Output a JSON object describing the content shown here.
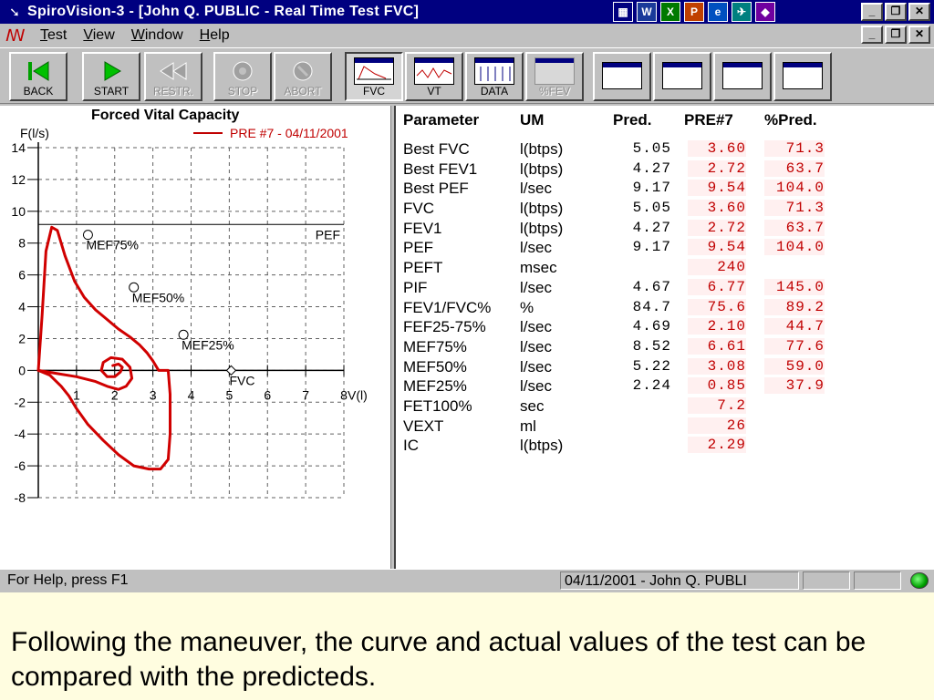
{
  "window": {
    "title": "SpiroVision-3 - [John Q. PUBLIC - Real Time Test FVC]",
    "min_glyph": "_",
    "max_glyph": "❐",
    "close_glyph": "✕"
  },
  "title_icons": [
    {
      "icon": "keyboard-icon",
      "glyph": "▦"
    },
    {
      "icon": "word-icon",
      "glyph": "W"
    },
    {
      "icon": "excel-icon",
      "glyph": "X"
    },
    {
      "icon": "powerpoint-icon",
      "glyph": "P"
    },
    {
      "icon": "ie-icon",
      "glyph": "e"
    },
    {
      "icon": "bird-icon",
      "glyph": "✈"
    },
    {
      "icon": "palette-icon",
      "glyph": "◆"
    }
  ],
  "menu": [
    "Test",
    "View",
    "Window",
    "Help"
  ],
  "toolbar": {
    "buttons": [
      {
        "label": "BACK",
        "icon": "back-icon",
        "enabled": true
      },
      {
        "label": "START",
        "icon": "play-icon",
        "enabled": true
      },
      {
        "label": "RESTR.",
        "icon": "rewind-icon",
        "enabled": false
      },
      {
        "label": "STOP",
        "icon": "stop-icon",
        "enabled": false
      },
      {
        "label": "ABORT",
        "icon": "abort-icon",
        "enabled": false
      }
    ],
    "views": [
      {
        "label": "FVC",
        "icon": "fvc-chart-icon",
        "pressed": true
      },
      {
        "label": "VT",
        "icon": "vt-chart-icon",
        "pressed": false
      },
      {
        "label": "DATA",
        "icon": "data-table-icon",
        "pressed": false
      },
      {
        "label": "%FEV",
        "icon": "fev-percent-icon",
        "pressed": false,
        "enabled": false
      }
    ],
    "extra_icons": [
      "report-icon",
      "multi-window-icon",
      "trend-icon",
      "print-preview-icon"
    ]
  },
  "chart_data": {
    "type": "line",
    "title": "Forced Vital Capacity",
    "legend": "PRE #7 - 04/11/2001",
    "ylabel": "F(l/s)",
    "xlabel": "V(l)",
    "xlim": [
      0,
      8
    ],
    "ylim": [
      -8,
      14
    ],
    "x_ticks": [
      "1",
      "2",
      "3",
      "4",
      "5",
      "6",
      "7",
      "8"
    ],
    "y_ticks": [
      "14",
      "12",
      "10",
      "8",
      "6",
      "4",
      "2",
      "0",
      "-2",
      "-4",
      "-6",
      "-8"
    ],
    "grid": true,
    "pef_line": {
      "y": 9.17,
      "label": "PEF"
    },
    "predicted_markers": [
      {
        "label": "MEF75%",
        "x": 1.3,
        "y": 8.52
      },
      {
        "label": "MEF50%",
        "x": 2.5,
        "y": 5.22
      },
      {
        "label": "MEF25%",
        "x": 3.8,
        "y": 2.24
      },
      {
        "label": "FVC",
        "x": 5.05,
        "y": 0
      }
    ],
    "series": [
      {
        "color": "#d00000",
        "x": [
          0.0,
          0.1,
          0.2,
          0.35,
          0.5,
          0.7,
          0.95,
          1.2,
          1.5,
          1.8,
          2.1,
          2.4,
          2.65,
          2.85,
          3.0,
          3.1,
          3.15,
          3.2,
          3.4,
          3.45,
          3.45,
          3.4,
          3.2,
          2.9,
          2.5,
          2.1,
          1.7,
          1.3,
          1.0,
          0.8,
          0.6,
          0.3,
          0.0
        ],
        "y": [
          0,
          3.5,
          7.5,
          9.0,
          8.8,
          7.2,
          5.6,
          4.6,
          3.8,
          3.2,
          2.6,
          2.1,
          1.6,
          1.1,
          0.6,
          0.2,
          0.0,
          0.0,
          0.0,
          -1.5,
          -4.0,
          -5.6,
          -6.2,
          -6.2,
          -6.0,
          -5.3,
          -4.4,
          -3.4,
          -2.4,
          -1.6,
          -1.0,
          -0.3,
          0.0
        ]
      },
      {
        "color": "#d00000",
        "x": [
          0.0,
          0.5,
          1.0,
          1.5,
          1.8,
          2.1,
          2.3,
          2.45,
          2.4,
          2.2,
          1.9,
          1.7,
          1.65,
          1.8,
          2.0,
          2.15,
          2.2,
          2.1,
          1.95
        ],
        "y": [
          0.0,
          -0.2,
          -0.4,
          -0.7,
          -1.0,
          -1.2,
          -1.0,
          -0.5,
          0.2,
          0.7,
          0.8,
          0.5,
          0.0,
          -0.4,
          -0.4,
          -0.1,
          0.2,
          0.4,
          0.3
        ]
      }
    ]
  },
  "table": {
    "headers": {
      "param": "Parameter",
      "um": "UM",
      "pred": "Pred.",
      "pre": "PRE#7",
      "pct": "%Pred."
    },
    "rows": [
      {
        "param": "Best FVC",
        "um": "l(btps)",
        "pred": "5.05",
        "pre": "3.60",
        "pct": "71.3"
      },
      {
        "param": "Best FEV1",
        "um": "l(btps)",
        "pred": "4.27",
        "pre": "2.72",
        "pct": "63.7"
      },
      {
        "param": "Best PEF",
        "um": "l/sec",
        "pred": "9.17",
        "pre": "9.54",
        "pct": "104.0"
      },
      {
        "param": "FVC",
        "um": "l(btps)",
        "pred": "5.05",
        "pre": "3.60",
        "pct": "71.3"
      },
      {
        "param": "FEV1",
        "um": "l(btps)",
        "pred": "4.27",
        "pre": "2.72",
        "pct": "63.7"
      },
      {
        "param": "PEF",
        "um": "l/sec",
        "pred": "9.17",
        "pre": "9.54",
        "pct": "104.0"
      },
      {
        "param": "PEFT",
        "um": "msec",
        "pred": "",
        "pre": "240",
        "pct": ""
      },
      {
        "param": "PIF",
        "um": "l/sec",
        "pred": "4.67",
        "pre": "6.77",
        "pct": "145.0"
      },
      {
        "param": "FEV1/FVC%",
        "um": "%",
        "pred": "84.7",
        "pre": "75.6",
        "pct": "89.2"
      },
      {
        "param": "FEF25-75%",
        "um": "l/sec",
        "pred": "4.69",
        "pre": "2.10",
        "pct": "44.7"
      },
      {
        "param": "MEF75%",
        "um": "l/sec",
        "pred": "8.52",
        "pre": "6.61",
        "pct": "77.6"
      },
      {
        "param": "MEF50%",
        "um": "l/sec",
        "pred": "5.22",
        "pre": "3.08",
        "pct": "59.0"
      },
      {
        "param": "MEF25%",
        "um": "l/sec",
        "pred": "2.24",
        "pre": "0.85",
        "pct": "37.9"
      },
      {
        "param": "FET100%",
        "um": "sec",
        "pred": "",
        "pre": "7.2",
        "pct": ""
      },
      {
        "param": "VEXT",
        "um": "ml",
        "pred": "",
        "pre": "26",
        "pct": ""
      },
      {
        "param": "IC",
        "um": "l(btps)",
        "pred": "",
        "pre": "2.29",
        "pct": ""
      }
    ]
  },
  "status": {
    "help": "For Help, press F1",
    "session": "04/11/2001 - John Q. PUBLI"
  },
  "caption": "Following the maneuver, the curve and actual values of the test can be compared with the predicteds."
}
